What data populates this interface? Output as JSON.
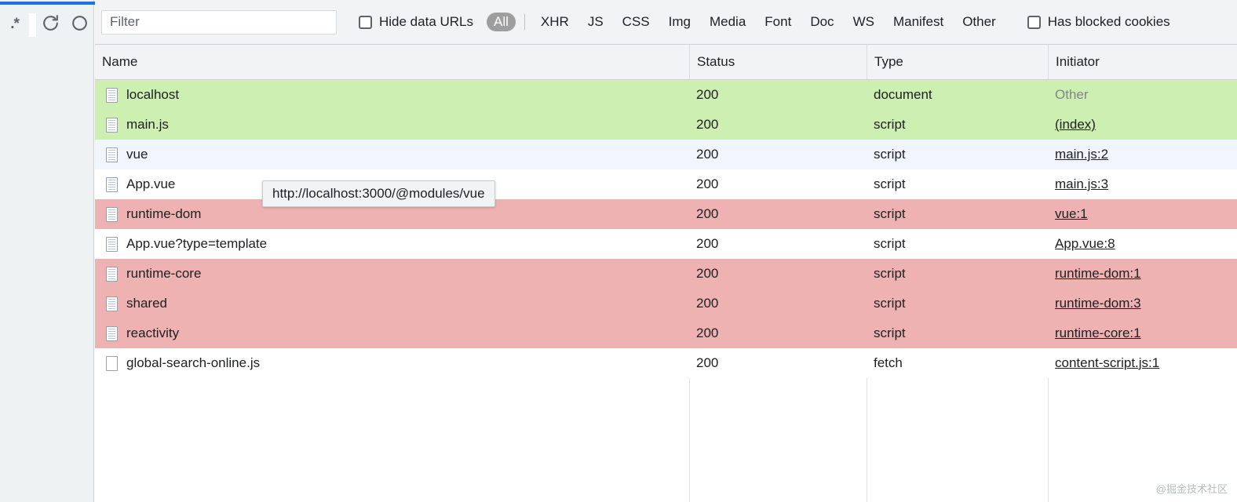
{
  "rail": {
    "regex_icon_label": ".*",
    "buttons": [
      {
        "name": "regex-filter-icon",
        "label": ".*"
      },
      {
        "name": "reload-icon",
        "label": ""
      },
      {
        "name": "record-circle-icon",
        "label": ""
      }
    ]
  },
  "toolbar": {
    "filter_placeholder": "Filter",
    "hide_data_urls_label": "Hide data URLs",
    "has_blocked_cookies_label": "Has blocked cookies",
    "active_type": "All",
    "types": [
      "All",
      "XHR",
      "JS",
      "CSS",
      "Img",
      "Media",
      "Font",
      "Doc",
      "WS",
      "Manifest",
      "Other"
    ],
    "active_pill_bg": "#9e9e9e"
  },
  "table": {
    "columns": [
      "Name",
      "Status",
      "Type",
      "Initiator"
    ],
    "rows": [
      {
        "name": "localhost",
        "status": "200",
        "type": "document",
        "initiator": "Other",
        "initiator_link": false,
        "icon": "file-lined-icon",
        "color": "green"
      },
      {
        "name": "main.js",
        "status": "200",
        "type": "script",
        "initiator": "(index)",
        "initiator_link": true,
        "icon": "file-lined-icon",
        "color": "green"
      },
      {
        "name": "vue",
        "status": "200",
        "type": "script",
        "initiator": "main.js:2",
        "initiator_link": true,
        "icon": "file-lined-icon",
        "color": "blue"
      },
      {
        "name": "App.vue",
        "status": "200",
        "type": "script",
        "initiator": "main.js:3",
        "initiator_link": true,
        "icon": "file-lined-icon",
        "color": "white"
      },
      {
        "name": "runtime-dom",
        "status": "200",
        "type": "script",
        "initiator": "vue:1",
        "initiator_link": true,
        "icon": "file-lined-icon",
        "color": "pink"
      },
      {
        "name": "App.vue?type=template",
        "status": "200",
        "type": "script",
        "initiator": "App.vue:8",
        "initiator_link": true,
        "icon": "file-lined-icon",
        "color": "white"
      },
      {
        "name": "runtime-core",
        "status": "200",
        "type": "script",
        "initiator": "runtime-dom:1",
        "initiator_link": true,
        "icon": "file-lined-icon",
        "color": "pink"
      },
      {
        "name": "shared",
        "status": "200",
        "type": "script",
        "initiator": "runtime-dom:3",
        "initiator_link": true,
        "icon": "file-lined-icon",
        "color": "pink"
      },
      {
        "name": "reactivity",
        "status": "200",
        "type": "script",
        "initiator": "runtime-core:1",
        "initiator_link": true,
        "icon": "file-lined-icon",
        "color": "pink"
      },
      {
        "name": "global-search-online.js",
        "status": "200",
        "type": "fetch",
        "initiator": "content-script.js:1",
        "initiator_link": true,
        "icon": "file-blank-icon",
        "color": "white"
      }
    ],
    "row_colors": {
      "green": "#cdefb1",
      "pink": "#eeb2b2",
      "blue": "#f1f5fd",
      "white": "#ffffff"
    }
  },
  "tooltip": {
    "text": "http://localhost:3000/@modules/vue"
  },
  "watermark": {
    "text": "@掘金技术社区"
  }
}
